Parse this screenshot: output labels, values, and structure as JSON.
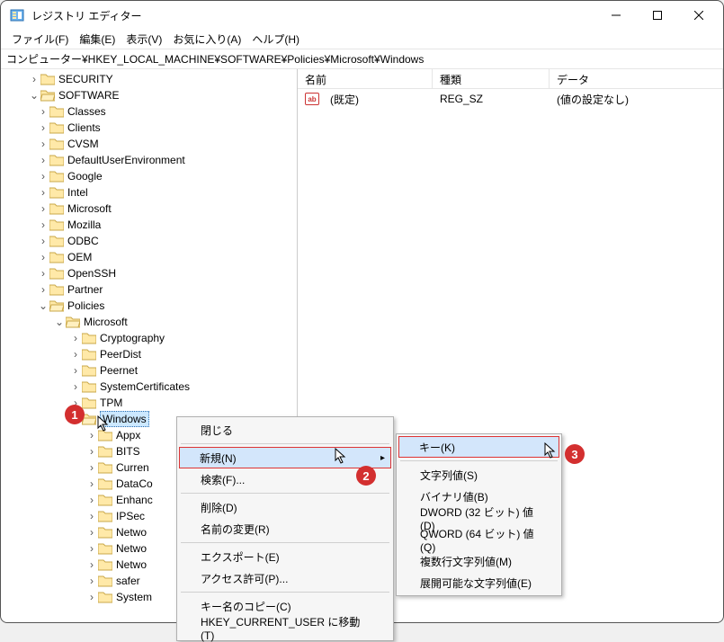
{
  "window_title": "レジストリ エディター",
  "menubar": [
    "ファイル(F)",
    "編集(E)",
    "表示(V)",
    "お気に入り(A)",
    "ヘルプ(H)"
  ],
  "address": "コンピューター¥HKEY_LOCAL_MACHINE¥SOFTWARE¥Policies¥Microsoft¥Windows",
  "columns": {
    "name": "名前",
    "type": "種類",
    "data": "データ"
  },
  "values_row": {
    "name": "(既定)",
    "type": "REG_SZ",
    "data": "(値の設定なし)"
  },
  "tree": {
    "security": "SECURITY",
    "software": "SOFTWARE",
    "sw_children": [
      "Classes",
      "Clients",
      "CVSM",
      "DefaultUserEnvironment",
      "Google",
      "Intel",
      "Microsoft",
      "Mozilla",
      "ODBC",
      "OEM",
      "OpenSSH",
      "Partner"
    ],
    "policies": "Policies",
    "pol_ms": "Microsoft",
    "ms_children_above": [
      "Cryptography",
      "PeerDist",
      "Peernet",
      "SystemCertificates",
      "TPM"
    ],
    "windows": "Windows",
    "win_children": [
      "Appx",
      "BITS",
      "Curren",
      "DataCo",
      "Enhanc",
      "IPSec",
      "Netwo",
      "Netwo",
      "Netwo",
      "safer",
      "System"
    ]
  },
  "context_menu": {
    "close": "閉じる",
    "new": "新規(N)",
    "find": "検索(F)...",
    "delete": "削除(D)",
    "rename": "名前の変更(R)",
    "export": "エクスポート(E)",
    "perm": "アクセス許可(P)...",
    "copykey": "キー名のコピー(C)",
    "movehkcu": "HKEY_CURRENT_USER に移動(T)"
  },
  "submenu": {
    "key": "キー(K)",
    "sz": "文字列値(S)",
    "bin": "バイナリ値(B)",
    "dword": "DWORD (32 ビット) 値(D)",
    "qword": "QWORD (64 ビット) 値(Q)",
    "multi": "複数行文字列値(M)",
    "expand": "展開可能な文字列値(E)"
  },
  "badges": {
    "b1": "1",
    "b2": "2",
    "b3": "3"
  }
}
